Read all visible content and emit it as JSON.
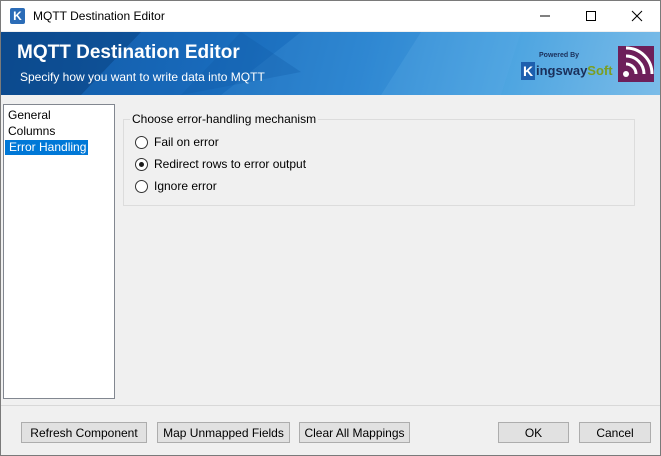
{
  "window": {
    "title": "MQTT Destination Editor",
    "icon": "kingswaysoft-k-icon"
  },
  "banner": {
    "title": "MQTT Destination Editor",
    "subtitle": "Specify how you want to write data into MQTT",
    "logo_powered": "Powered By",
    "logo_k": "K",
    "logo_name": "ingsway",
    "logo_soft": "Soft"
  },
  "nav": {
    "items": [
      {
        "label": "General",
        "selected": false
      },
      {
        "label": "Columns",
        "selected": false
      },
      {
        "label": "Error Handling",
        "selected": true
      }
    ]
  },
  "error_handling": {
    "group_label": "Choose error-handling mechanism",
    "options": [
      {
        "label": "Fail on error",
        "selected": false
      },
      {
        "label": "Redirect rows to error output",
        "selected": true
      },
      {
        "label": "Ignore error",
        "selected": false
      }
    ]
  },
  "footer": {
    "refresh_label": "Refresh Component",
    "map_label": "Map Unmapped Fields",
    "clear_label": "Clear All Mappings",
    "ok_label": "OK",
    "cancel_label": "Cancel"
  },
  "colors": {
    "banner_dark": "#0d4f97",
    "banner_light": "#7bbce8",
    "selection": "#0078d7",
    "logo_mark": "#6d1f5a"
  }
}
